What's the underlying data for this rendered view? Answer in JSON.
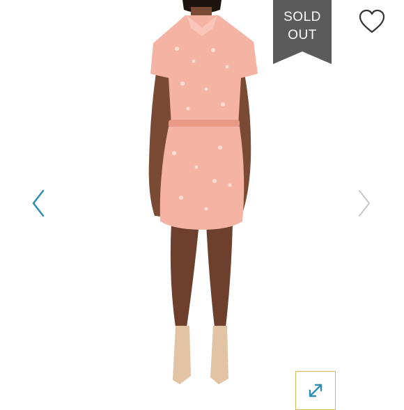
{
  "badge": {
    "line1": "SOLD",
    "line2": "OUT",
    "color": "#5b5b5b"
  },
  "icons": {
    "favorite": "heart-outline-icon",
    "prev": "chevron-left-icon",
    "next": "chevron-right-icon",
    "expand": "expand-diagonal-icon"
  },
  "colors": {
    "accent": "#2e8fb0",
    "expand_border": "#d6b656",
    "dress": "#f5b3a3",
    "arrow_inactive": "#c8c8c8"
  }
}
